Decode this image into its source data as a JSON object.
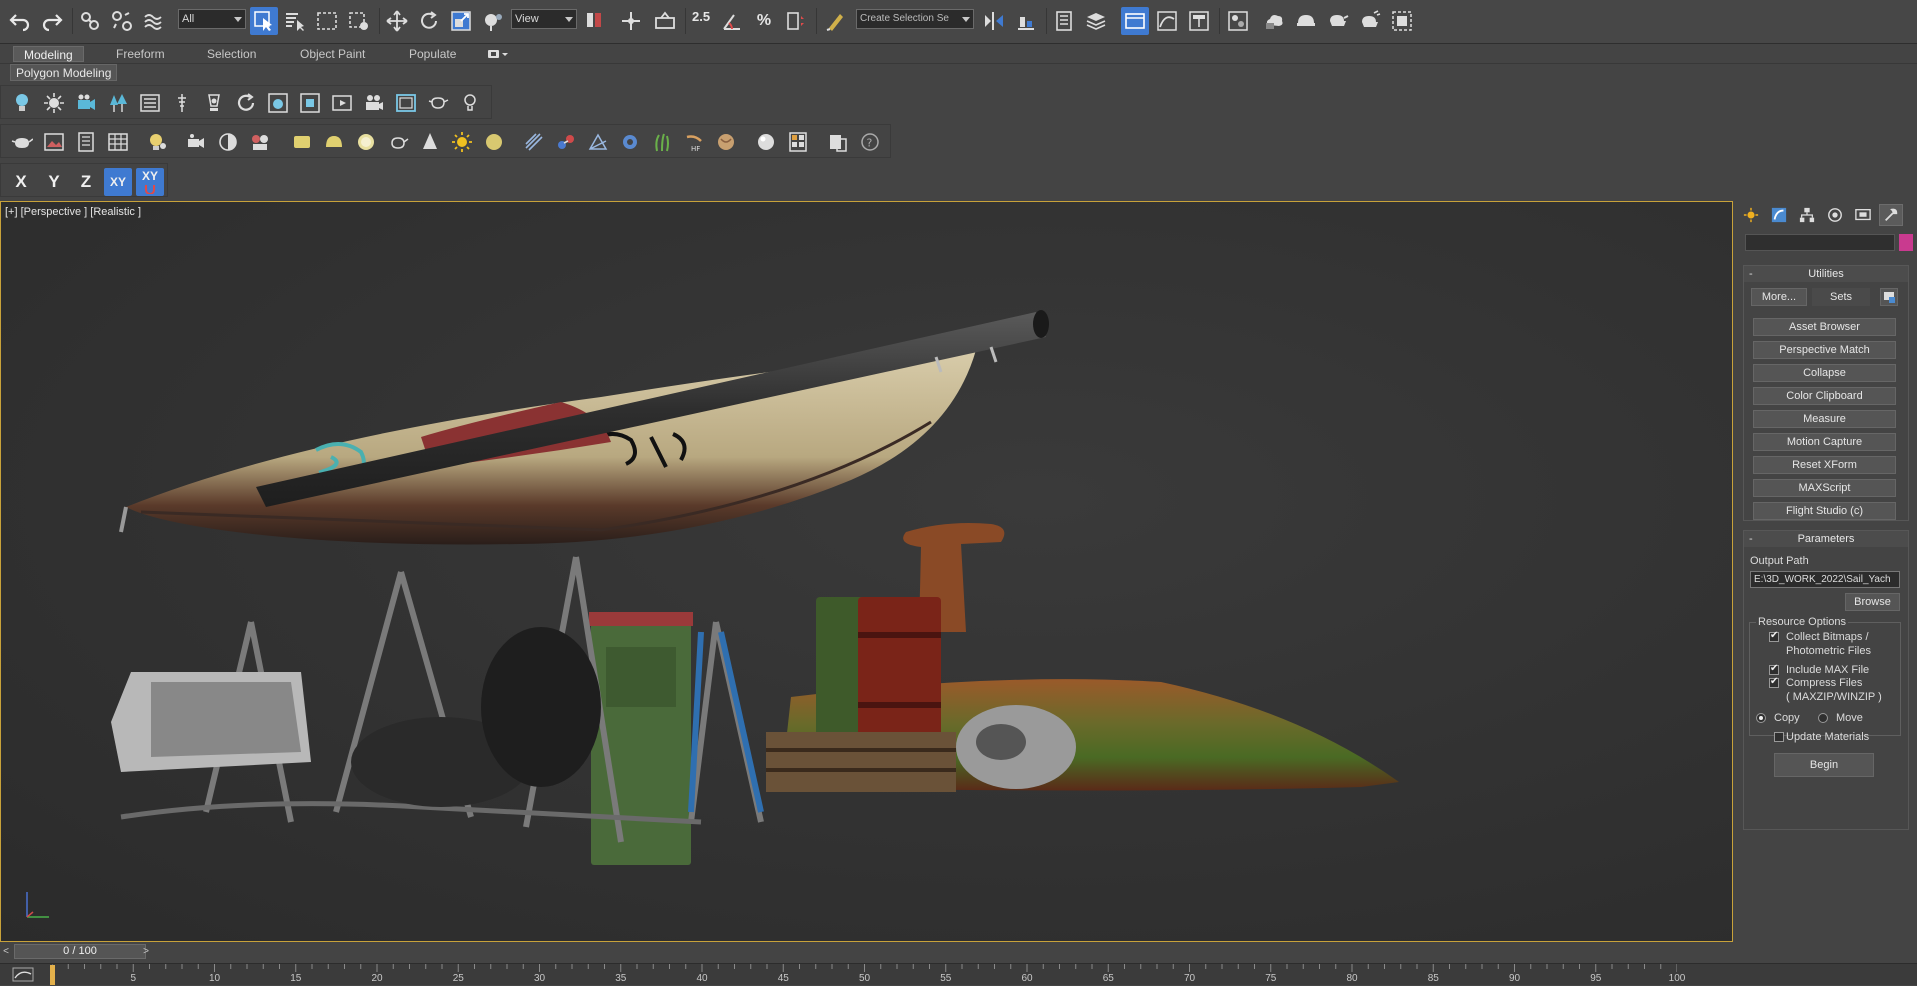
{
  "main_toolbar": {
    "selection_filter": "All",
    "ref_coord": "View",
    "snap_value": "2.5",
    "angle_snap_pct": "%",
    "named_selection_placeholder": "Create Selection Se"
  },
  "ribbon": {
    "tabs": [
      {
        "label": "Modeling",
        "active": true
      },
      {
        "label": "Freeform",
        "active": false
      },
      {
        "label": "Selection",
        "active": false
      },
      {
        "label": "Object Paint",
        "active": false
      },
      {
        "label": "Populate",
        "active": false
      }
    ],
    "panel_label": "Polygon Modeling"
  },
  "axis_constraints": {
    "x": "X",
    "y": "Y",
    "z": "Z",
    "xy": "XY",
    "xy_lock": "XY"
  },
  "viewport": {
    "label": "[+] [Perspective ] [Realistic ]"
  },
  "command_panel": {
    "name_color": "#c93a8f",
    "utilities": {
      "title": "Utilities",
      "more_button": "More...",
      "sets_button": "Sets",
      "items": [
        "Asset Browser",
        "Perspective Match",
        "Collapse",
        "Color Clipboard",
        "Measure",
        "Motion Capture",
        "Reset XForm",
        "MAXScript",
        "Flight Studio (c)"
      ]
    },
    "parameters": {
      "title": "Parameters",
      "output_path_label": "Output Path",
      "output_path_value": "E:\\3D_WORK_2022\\Sail_Yach",
      "browse_button": "Browse",
      "resource_options_label": "Resource Options",
      "collect_bitmaps_line1": "Collect Bitmaps /",
      "collect_bitmaps_line2": "Photometric Files",
      "collect_bitmaps_checked": true,
      "include_max_label": "Include MAX File",
      "include_max_checked": true,
      "compress_label": "Compress Files",
      "compress_sub": "( MAXZIP/WINZIP )",
      "compress_checked": true,
      "copy_label": "Copy",
      "move_label": "Move",
      "copy_selected": true,
      "update_materials_label": "Update Materials",
      "update_materials_checked": false,
      "begin_button": "Begin"
    }
  },
  "timeline": {
    "slider_text": "0 / 100",
    "prev_arrow": "<",
    "next_arrow": ">",
    "current_frame": 0,
    "ticks": [
      5,
      10,
      15,
      20,
      25,
      30,
      35,
      40,
      45,
      50,
      55,
      60,
      65,
      70,
      75,
      80,
      85,
      90,
      95,
      100
    ],
    "tick_labels": [
      "5",
      "10",
      "15",
      "20",
      "25",
      "30",
      "35",
      "40",
      "45",
      "50",
      "55",
      "60",
      "65",
      "70",
      "75",
      "80",
      "85",
      "90",
      "95",
      "100"
    ]
  },
  "colors": {
    "active_blue": "#3f7ad1",
    "viewport_border": "#c8a23a",
    "time_cursor": "#e3b04b"
  }
}
